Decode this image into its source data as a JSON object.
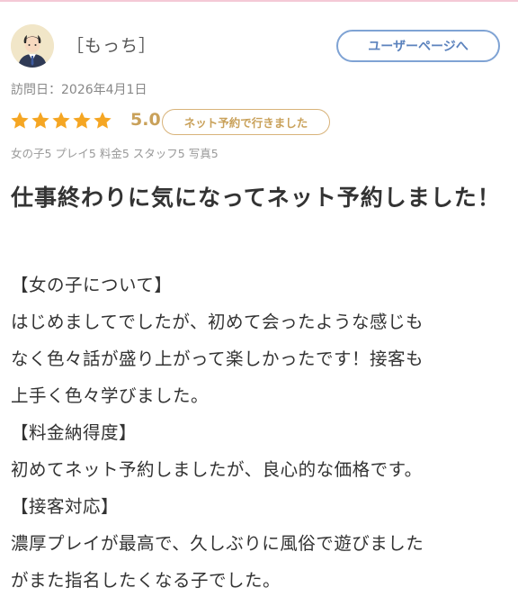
{
  "user": {
    "name": "［もっち］",
    "user_page_label": "ユーザーページへ"
  },
  "visit": {
    "label": "訪問日：2026年4月1日"
  },
  "rating": {
    "stars": 5,
    "star_color": "#f5a623",
    "score": "5.0",
    "badge": "ネット予約で行きました"
  },
  "category_scores": "女の子5 プレイ5 料金5 スタッフ5 写真5",
  "review": {
    "title": "仕事終わりに気になってネット予約しました！",
    "lines": [
      "【女の子について】",
      "はじめましてでしたが、初めて会ったような感じも",
      "なく色々話が盛り上がって楽しかったです！接客も",
      "上手く色々学びました。",
      "【料金納得度】",
      "初めてネット予約しましたが、良心的な価格です。",
      "【接客対応】",
      "濃厚プレイが最高で、久しぶりに風俗で遊びました",
      "がまた指名したくなる子でした。"
    ]
  },
  "colors": {
    "accent_blue": "#7fa3d4",
    "accent_gold": "#c9a15a",
    "top_rule_pink": "#f4c9d6"
  }
}
